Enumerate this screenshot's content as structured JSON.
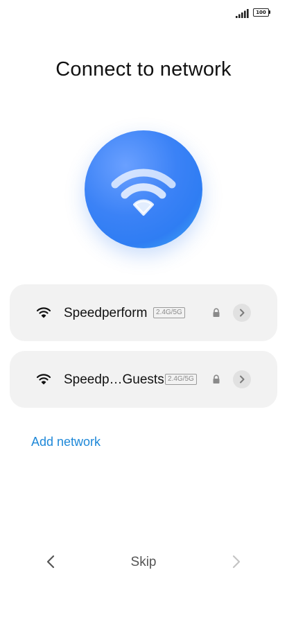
{
  "status_bar": {
    "battery_level": "100",
    "signal_bars": 4
  },
  "title": "Connect to network",
  "hero": {
    "icon": "wifi-icon",
    "colors": {
      "center": "#6aa0ff",
      "edge": "#43b3f5"
    }
  },
  "networks": [
    {
      "name": "Speedperform",
      "band": "2.4G/5G",
      "secured": true
    },
    {
      "name": "Speedp…Guests",
      "band": "2.4G/5G",
      "secured": true
    }
  ],
  "add_network_label": "Add network",
  "bottom_nav": {
    "back_icon": "chevron-left-icon",
    "skip_label": "Skip",
    "next_icon": "chevron-right-icon"
  },
  "colors": {
    "accent": "#1e88d8",
    "card_bg": "#f2f2f2"
  }
}
